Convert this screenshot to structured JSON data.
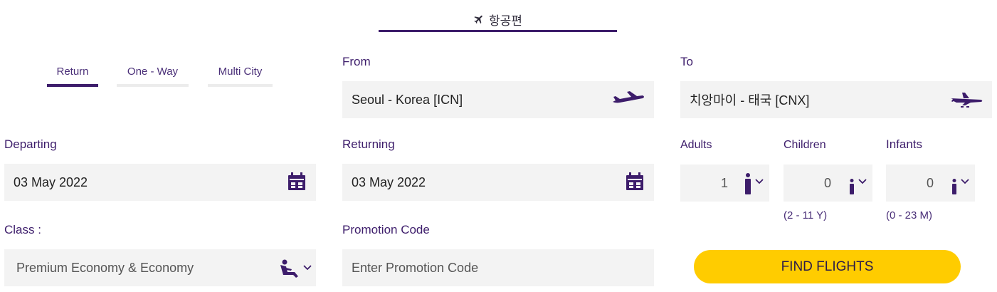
{
  "tabs": {
    "flights_label": "항공편"
  },
  "trip_types": [
    {
      "label": "Return",
      "active": true
    },
    {
      "label": "One - Way",
      "active": false
    },
    {
      "label": "Multi City",
      "active": false
    }
  ],
  "from": {
    "label": "From",
    "value": "Seoul - Korea [ICN]",
    "icon": "plane-departure-icon"
  },
  "to": {
    "label": "To",
    "value": "치앙마이 - 태국 [CNX]",
    "icon": "plane-arrival-icon"
  },
  "departing": {
    "label": "Departing",
    "value": "03 May 2022",
    "icon": "calendar-icon"
  },
  "returning": {
    "label": "Returning",
    "value": "03 May 2022",
    "icon": "calendar-icon"
  },
  "passengers": {
    "adults": {
      "label": "Adults",
      "value": "1",
      "hint": ""
    },
    "children": {
      "label": "Children",
      "value": "0",
      "hint": "(2 - 11 Y)"
    },
    "infants": {
      "label": "Infants",
      "value": "0",
      "hint": "(0 - 23 M)"
    }
  },
  "class": {
    "label": "Class :",
    "value": "Premium Economy & Economy",
    "icon": "seat-icon"
  },
  "promo": {
    "label": "Promotion Code",
    "placeholder": "Enter Promotion Code"
  },
  "find_button": {
    "label": "FIND FLIGHTS"
  },
  "colors": {
    "primary": "#3d1d6b",
    "accent": "#ffcc00",
    "field_bg": "#f3f3f3"
  }
}
